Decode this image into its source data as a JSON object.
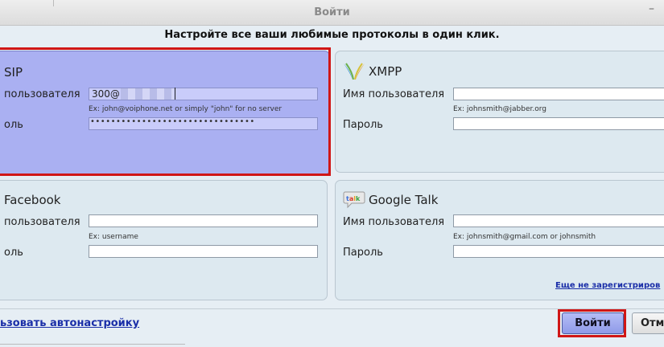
{
  "window": {
    "title": "Войти",
    "minimize_symbol": "–"
  },
  "banner": "Настройте все ваши любимые протоколы в один клик.",
  "sip": {
    "title": "SIP",
    "username_label": "пользователя",
    "username_value": "300@",
    "username_hint": "Ex: john@voiphone.net or simply \"john\" for no server",
    "password_label": "оль",
    "password_value": "••••••••••••••••••••••••••••••••"
  },
  "xmpp": {
    "title": "XMPP",
    "username_label": "Имя пользователя",
    "username_hint": "Ex: johnsmith@jabber.org",
    "password_label": "Пароль"
  },
  "facebook": {
    "title": "Facebook",
    "username_label": "пользователя",
    "username_hint": "Ex: username",
    "password_label": "оль"
  },
  "gtalk": {
    "title": "Google Talk",
    "icon_text": "talk",
    "username_label": "Имя пользователя",
    "username_hint": "Ex: johnsmith@gmail.com or johnsmith",
    "password_label": "Пароль",
    "register_link": "Еще не зарегистриров"
  },
  "footer": {
    "autoconfig_link": "ьзовать автонастройку",
    "login_button": "Войти",
    "cancel_button": "Отм"
  },
  "colors": {
    "highlight": "#d01616",
    "sip_panel": "#aab0f2",
    "link": "#1a2ea8"
  }
}
